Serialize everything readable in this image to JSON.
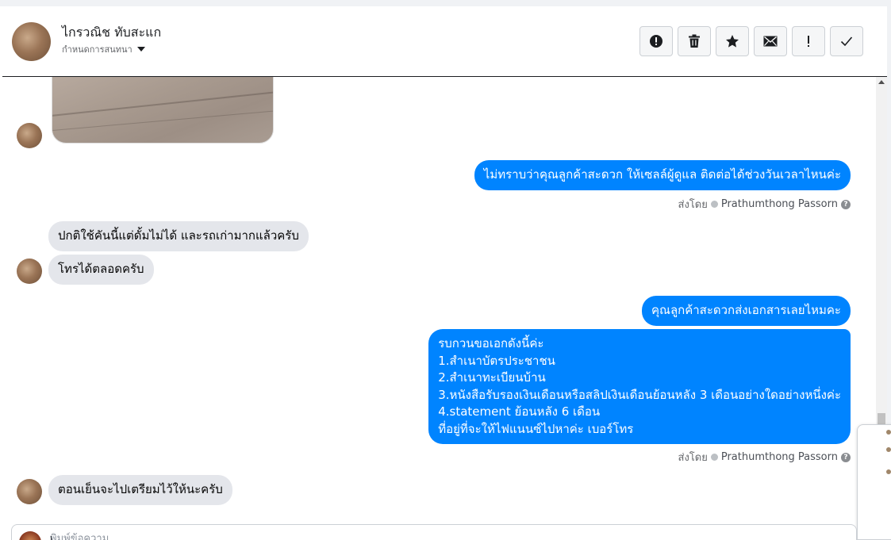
{
  "header": {
    "contact_name": "ไกรวณิช ทับสะแก",
    "subtitle": "กำหนดการสนทนา"
  },
  "actions": [
    {
      "name": "report-button",
      "icon": "alert-circle-icon"
    },
    {
      "name": "delete-button",
      "icon": "trash-icon"
    },
    {
      "name": "star-button",
      "icon": "star-icon"
    },
    {
      "name": "mail-button",
      "icon": "envelope-icon"
    },
    {
      "name": "important-button",
      "icon": "exclamation-icon"
    },
    {
      "name": "done-button",
      "icon": "checkmark-icon"
    }
  ],
  "messages": {
    "m1": "ไม่ทราบว่าคุณลูกค้าสะดวก ให้เซลล์ผู้ดูแล ติดต่อได้ช่วงวันเวลาไหนค่ะ",
    "m2": "ปกติใช้คันนี้แต่ดั้มไม่ได้ และรถเก่ามากแล้วครับ",
    "m3": "โทรได้ตลอดครับ",
    "m4": "คุณลูกค้าสะดวกส่งเอกสารเลยไหมคะ",
    "m5_lines": [
      "รบกวนขอเอกดังนี้ค่ะ",
      "1.สำเนาบัตรประชาชน",
      "2.สำเนาทะเบียนบ้าน",
      "3.หนังสือรับรองเงินเดือนหรือสลิปเงินเดือนย้อนหลัง 3 เดือนอย่างใดอย่างหนึ่งค่ะ",
      "4.statement ย้อนหลัง 6 เดือน",
      "ที่อยู่ที่จะให้ไฟแนนซ์ไปหาค่ะ เบอร์โทร"
    ],
    "m6": "ตอนเย็นจะไปเตรียมไว้ให้นะครับ"
  },
  "sent_by": {
    "label": "ส่งโดย",
    "agent": "Prathumthong Passorn"
  },
  "composer": {
    "placeholder": "พิมพ์ข้อความ..."
  },
  "colors": {
    "outgoing": "#0084ff",
    "incoming": "#e4e6eb"
  }
}
